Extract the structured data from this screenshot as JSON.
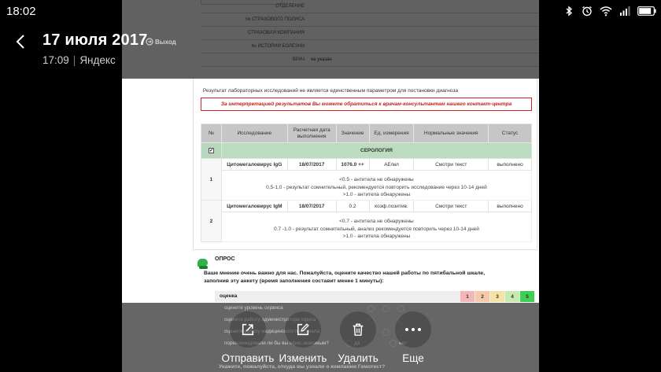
{
  "status_bar": {
    "time": "18:02",
    "battery_level": 0.85
  },
  "header": {
    "title": "17 июля 2017",
    "subtitle_time": "17:09",
    "subtitle_source": "Яндекс",
    "exit_label": "Выход"
  },
  "document": {
    "patient_info": [
      {
        "label": "ОТДЕЛЕНИЕ",
        "value": ""
      },
      {
        "label": "№ СТРАХОВОГО ПОЛИСА",
        "value": ""
      },
      {
        "label": "СТРАХОВАЯ КОМПАНИЯ",
        "value": ""
      },
      {
        "label": "№ ИСТОРИИ БОЛЕЗНИ",
        "value": ""
      },
      {
        "label": "ВРАЧ",
        "value": "не указан"
      }
    ],
    "note": "Результат лабораторных исследований не является единственным параметром для постановки диагноза",
    "warning": "За интерпретацией результатов Вы можете обратиться к врачам-консультантам нашего контакт-центра",
    "table_headers": [
      "№",
      "Исследование",
      "Расчетная дата выполнения",
      "Значение",
      "Ед. измерения",
      "Нормальные значения",
      "Статус"
    ],
    "section_checkbox": "✔",
    "section": "СЕРОЛОГИЯ",
    "rows": [
      {
        "num": "1",
        "name": "Цитомегаловирус IgG",
        "date": "18/07/2017",
        "value": "1076.0 ++",
        "unit": "АЕ/мл",
        "normal": "Смотри текст",
        "status": "выполнено",
        "ref": [
          "<0.5 - антитела не обнаружены",
          "0,5-1,0 - результат сомнительный, рекомендуется повторить исследование через 10-14 дней",
          ">1.0 - антитела обнаружены"
        ]
      },
      {
        "num": "2",
        "name": "Цитомегаловирус IgM",
        "date": "18/07/2017",
        "value": "0.2",
        "unit": "коэф.позитив.",
        "normal": "Смотри текст",
        "status": "выполнено",
        "ref": [
          "<0.7 - антитела не обнаружены",
          "0.7 -1.0 - результат сомнительный, анализ рекомендуется повторить через 10-14 дней",
          ">1.0 - антитела обнаружены"
        ]
      }
    ],
    "survey": {
      "title": "ОПРОС",
      "text": "Ваше мнение очень важно для нас. Пожалуйста, оцените качество нашей работы по пятибальной шкале, заполнив эту анкету (время заполнения составит менее 1 минуты):",
      "rating_label": "оценка",
      "ratings": [
        "1",
        "2",
        "3",
        "4",
        "5"
      ],
      "rating_colors": [
        "#f4b6b6",
        "#f6c9a8",
        "#f5e2a6",
        "#c6eab0",
        "#3fcf52"
      ],
      "questions": [
        "оцените уровень сервиса",
        "оцените работу администратора офиса",
        "оцените работу медицинского персонала",
        "порекомендовали ли бы вы офис знакомым?"
      ],
      "answer_yes": "да",
      "answer_no": "нет",
      "footer": "Укажите, пожалуйста, откуда вы узнали о компании Гемотест?"
    }
  },
  "actions": [
    {
      "label": "Отправить",
      "icon": "share-icon"
    },
    {
      "label": "Изменить",
      "icon": "edit-icon"
    },
    {
      "label": "Удалить",
      "icon": "trash-icon"
    },
    {
      "label": "Еще",
      "icon": "more-icon"
    }
  ]
}
